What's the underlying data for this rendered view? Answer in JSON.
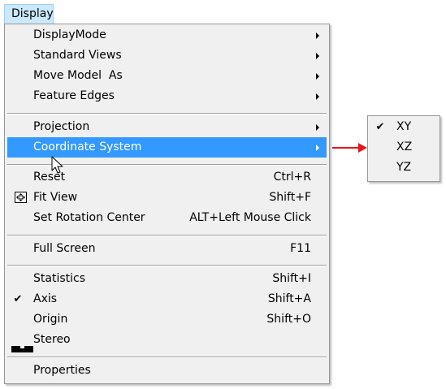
{
  "menu_bar": {
    "display_label": "Display"
  },
  "menu": {
    "items": [
      {
        "label": "DisplayMode",
        "submenu": true
      },
      {
        "label": "Standard Views",
        "submenu": true
      },
      {
        "label": "Move Model  As",
        "submenu": true
      },
      {
        "label": "Feature Edges",
        "submenu": true
      },
      {
        "label": "Projection",
        "submenu": true
      },
      {
        "label": "Coordinate System",
        "submenu": true,
        "highlighted": true
      },
      {
        "label": "Reset",
        "shortcut": "Ctrl+R"
      },
      {
        "label": "Fit View",
        "shortcut": "Shift+F",
        "icon": "fit-view-icon"
      },
      {
        "label": "Set Rotation Center",
        "shortcut": "ALT+Left Mouse Click"
      },
      {
        "label": "Full Screen",
        "shortcut": "F11"
      },
      {
        "label": "Statistics",
        "shortcut": "Shift+I"
      },
      {
        "label": "Axis",
        "shortcut": "Shift+A",
        "checked": true
      },
      {
        "label": "Origin",
        "shortcut": "Shift+O"
      },
      {
        "label": "Stereo",
        "icon": "stereo-icon"
      },
      {
        "label": "Properties"
      }
    ]
  },
  "submenu": {
    "items": [
      {
        "label": "XY",
        "checked": true
      },
      {
        "label": "XZ"
      },
      {
        "label": "YZ"
      }
    ]
  },
  "glyphs": {
    "check": "✔"
  },
  "colors": {
    "highlight": "#3399ff",
    "menu_bg": "#f0f0f0",
    "title_bg": "#cce8ff",
    "annotation_arrow": "#e8141c"
  }
}
